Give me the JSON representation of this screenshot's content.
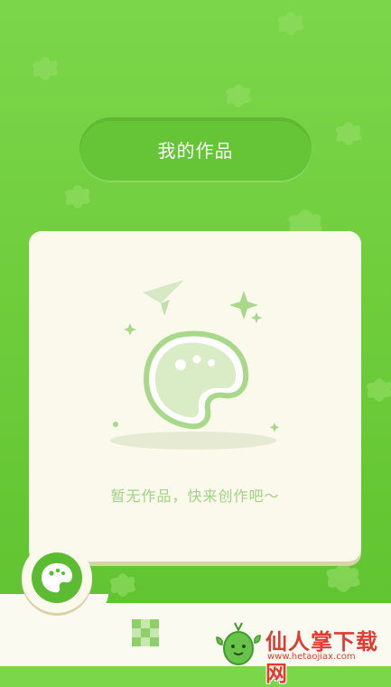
{
  "header": {
    "title": "我的作品"
  },
  "empty_state": {
    "message": "暂无作品，快来创作吧～",
    "illustration_icon": "palette-icon"
  },
  "fab": {
    "icon": "palette-icon"
  },
  "bottom_nav": {
    "items": [
      {
        "icon": "checker-grid-icon"
      }
    ]
  },
  "watermark": {
    "title": "仙人掌下载网",
    "url": "www.hetaojiax.com"
  },
  "colors": {
    "background_top": "#7cd64a",
    "background_bottom": "#5ec22f",
    "card": "#fbf9ec",
    "accent_green": "#5bbb33",
    "empty_text": "#9fd37f"
  }
}
